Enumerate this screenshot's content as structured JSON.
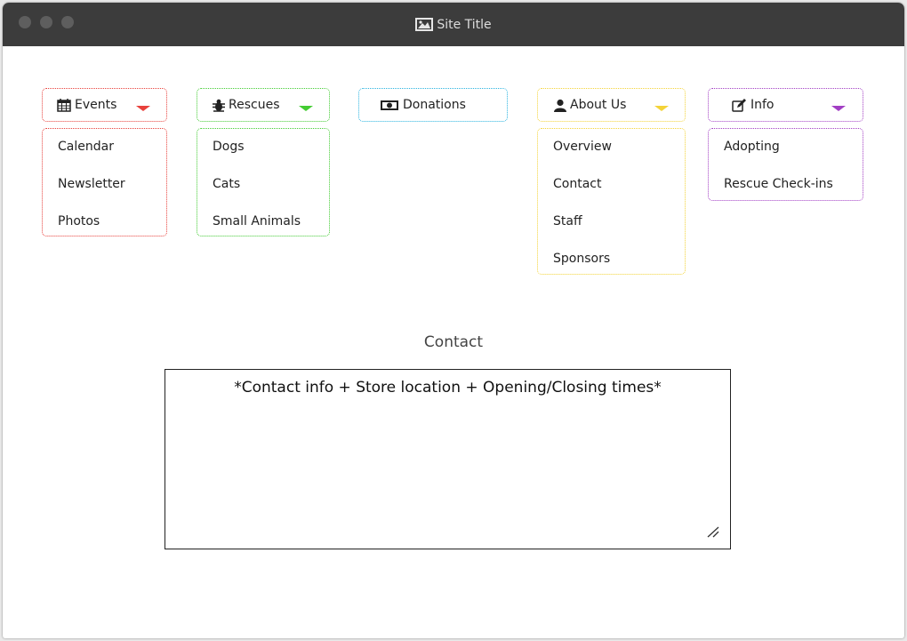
{
  "window": {
    "title": "Site Title"
  },
  "nav": {
    "events": {
      "label": "Events",
      "icon": "calendar-icon",
      "color": "#e8413c",
      "items": [
        "Calendar",
        "Newsletter",
        "Photos"
      ]
    },
    "rescues": {
      "label": "Rescues",
      "icon": "bug-icon",
      "color": "#44cc33",
      "items": [
        "Dogs",
        "Cats",
        "Small Animals"
      ]
    },
    "donations": {
      "label": "Donations",
      "icon": "money-icon",
      "color": "#2bb4e0"
    },
    "about": {
      "label": "About Us",
      "icon": "user-icon",
      "color": "#f4d338",
      "items": [
        "Overview",
        "Contact",
        "Staff",
        "Sponsors"
      ]
    },
    "info": {
      "label": "Info",
      "icon": "edit-icon",
      "color": "#a23fc4",
      "items": [
        "Adopting",
        "Rescue Check-ins"
      ]
    }
  },
  "main": {
    "heading": "Contact",
    "textarea_value": "*Contact info + Store location + Opening/Closing times*"
  }
}
